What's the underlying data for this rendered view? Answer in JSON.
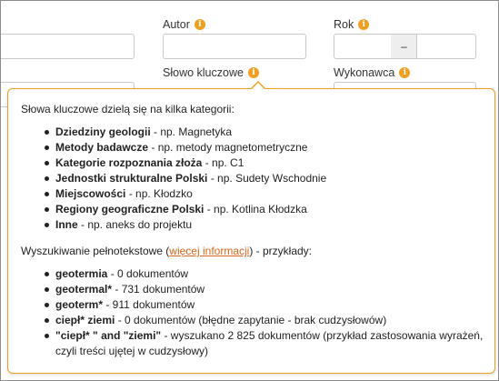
{
  "form": {
    "autor_label": "Autor",
    "rok_label": "Rok",
    "slowo_label": "Słowo kluczowe",
    "wykonawca_label": "Wykonawca",
    "range_separator": "–"
  },
  "popover": {
    "intro": "Słowa kluczowe dzielą się na kilka kategorii:",
    "categories": [
      {
        "name": "Dziedziny geologii",
        "example": " - np. Magnetyka"
      },
      {
        "name": "Metody badawcze",
        "example": " - np. metody magnetometryczne"
      },
      {
        "name": "Kategorie rozpoznania złoża",
        "example": " - np. C1"
      },
      {
        "name": "Jednostki strukturalne Polski",
        "example": " - np. Sudety Wschodnie"
      },
      {
        "name": "Miejscowości",
        "example": " - np. Kłodzko"
      },
      {
        "name": "Regiony geograficzne Polski",
        "example": " - np. Kotlina Kłodzka"
      },
      {
        "name": "Inne",
        "example": " - np. aneks do projektu"
      }
    ],
    "fulltext_prefix": "Wyszukiwanie pełnotekstowe (",
    "fulltext_link": "więcej informacji",
    "fulltext_suffix": ") - przykłady:",
    "examples": [
      {
        "term": "geotermia",
        "result": " - 0 dokumentów"
      },
      {
        "term": "geotermal*",
        "result": " - 731 dokumentów"
      },
      {
        "term": "geoterm*",
        "result": " - 911 dokumentów"
      },
      {
        "term": "ciepł* ziemi",
        "result": " - 0 dokumentów (błędne zapytanie - brak cudzysłowów)"
      },
      {
        "term": "\"ciepł* \" and \"ziemi\"",
        "result": " - wyszukano 2 825 dokumentów (przykład zastosowania wyrażeń, czyli treści ujętej w cudzysłowy)"
      }
    ]
  },
  "colors": {
    "accent": "#f0a020",
    "link": "#d9661a"
  },
  "icons": {
    "info": "info-icon"
  }
}
